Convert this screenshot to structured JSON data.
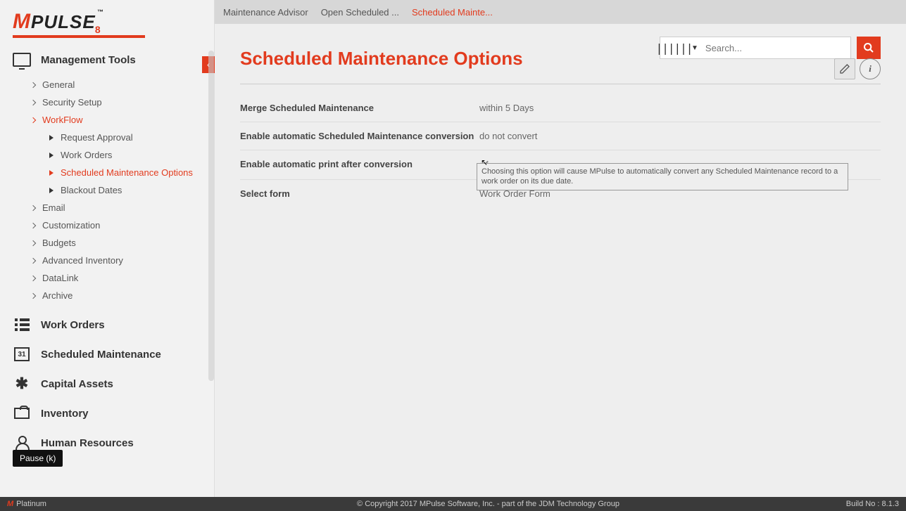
{
  "logo": {
    "text_m": "M",
    "text_rest": "PULSE",
    "tm": "™",
    "sub": "8"
  },
  "sidebar": {
    "title": "Management Tools",
    "items": [
      {
        "label": "General"
      },
      {
        "label": "Security Setup"
      },
      {
        "label": "WorkFlow",
        "active": true
      },
      {
        "label": "Email"
      },
      {
        "label": "Customization"
      },
      {
        "label": "Budgets"
      },
      {
        "label": "Advanced Inventory"
      },
      {
        "label": "DataLink"
      },
      {
        "label": "Archive"
      }
    ],
    "workflow_children": [
      {
        "label": "Request Approval"
      },
      {
        "label": "Work Orders"
      },
      {
        "label": "Scheduled Maintenance Options",
        "active": true
      },
      {
        "label": "Blackout Dates"
      }
    ],
    "sections": [
      {
        "label": "Work Orders"
      },
      {
        "label": "Scheduled Maintenance",
        "badge": "31"
      },
      {
        "label": "Capital Assets"
      },
      {
        "label": "Inventory"
      },
      {
        "label": "Human Resources"
      }
    ]
  },
  "breadcrumbs": [
    {
      "label": "Maintenance Advisor"
    },
    {
      "label": "Open Scheduled ..."
    },
    {
      "label": "Scheduled Mainte...",
      "active": true
    }
  ],
  "search": {
    "placeholder": "Search..."
  },
  "page": {
    "title": "Scheduled Maintenance Options",
    "rows": [
      {
        "label": "Merge Scheduled Maintenance",
        "value": "within 5 Days"
      },
      {
        "label": "Enable automatic Scheduled Maintenance conversion",
        "value": "do not convert"
      },
      {
        "label": "Enable automatic print after conversion",
        "value_check": true
      },
      {
        "label": "Select form",
        "value": "Work Order Form"
      }
    ],
    "tooltip": "Choosing this option will cause MPulse to automatically convert any Scheduled  Maintenance record to a work order on its due date."
  },
  "overlay": {
    "pause": "Pause (k)"
  },
  "footer": {
    "platinum": "Platinum",
    "copyright": "© Copyright 2017 MPulse Software, Inc. - part of the JDM Technology Group",
    "build": "Build No : 8.1.3"
  }
}
